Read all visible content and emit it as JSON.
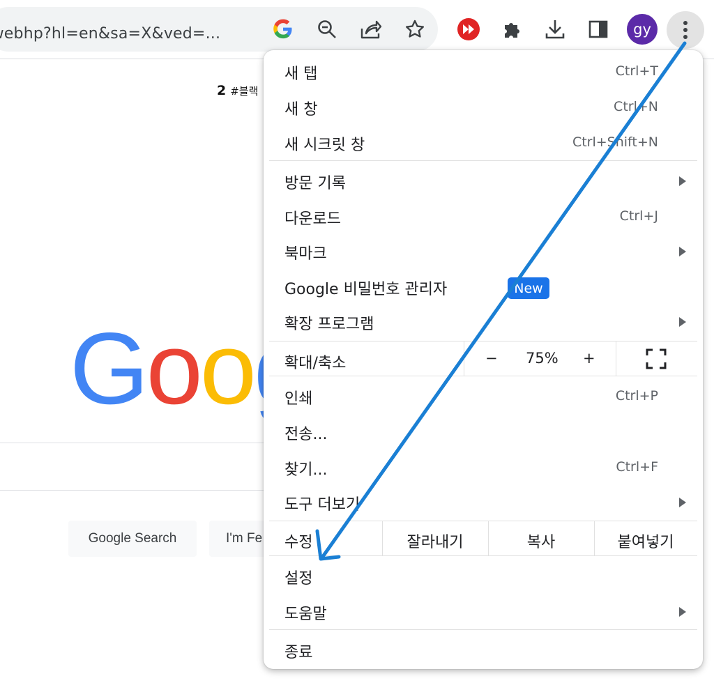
{
  "toolbar": {
    "url": "/webhp?hl=en&sa=X&ved=...",
    "avatar_initials": "gy",
    "icons": [
      "google-g-icon",
      "zoom-out-icon",
      "share-icon",
      "star-icon",
      "extension-red-icon",
      "puzzle-extensions-icon",
      "download-icon",
      "side-panel-icon",
      "kebab-menu-icon"
    ]
  },
  "page": {
    "top_text_num": "2",
    "top_text_rest": "#블랙",
    "logo_letters": [
      "G",
      "o",
      "o",
      "g"
    ],
    "logo_colors": [
      "#4285F4",
      "#EA4335",
      "#FBBC05",
      "#4285F4"
    ],
    "google_search_label": "Google Search",
    "lucky_label": "I'm Fe"
  },
  "menu": {
    "items": {
      "new_tab": {
        "label": "새 탭",
        "shortcut": "Ctrl+T"
      },
      "new_window": {
        "label": "새 창",
        "shortcut": "Ctrl+N"
      },
      "incognito": {
        "label": "새 시크릿 창",
        "shortcut": "Ctrl+Shift+N"
      },
      "history": {
        "label": "방문 기록"
      },
      "downloads": {
        "label": "다운로드",
        "shortcut": "Ctrl+J"
      },
      "bookmarks": {
        "label": "북마크"
      },
      "passwords": {
        "label": "Google 비밀번호 관리자",
        "badge": "New"
      },
      "extensions": {
        "label": "확장 프로그램"
      },
      "print": {
        "label": "인쇄",
        "shortcut": "Ctrl+P"
      },
      "cast": {
        "label": "전송..."
      },
      "find": {
        "label": "찾기...",
        "shortcut": "Ctrl+F"
      },
      "more_tools": {
        "label": "도구 더보기"
      },
      "settings": {
        "label": "설정"
      },
      "help": {
        "label": "도움말"
      },
      "exit": {
        "label": "종료"
      }
    },
    "zoom": {
      "label": "확대/축소",
      "minus": "−",
      "value": "75%",
      "plus": "+"
    },
    "edit": {
      "label": "수정",
      "cut": "잘라내기",
      "copy": "복사",
      "paste": "붙여넣기"
    }
  },
  "colors": {
    "accent": "#1a73e8",
    "annotation_arrow": "#1a7fd4",
    "avatar": "#5b2aa8"
  }
}
